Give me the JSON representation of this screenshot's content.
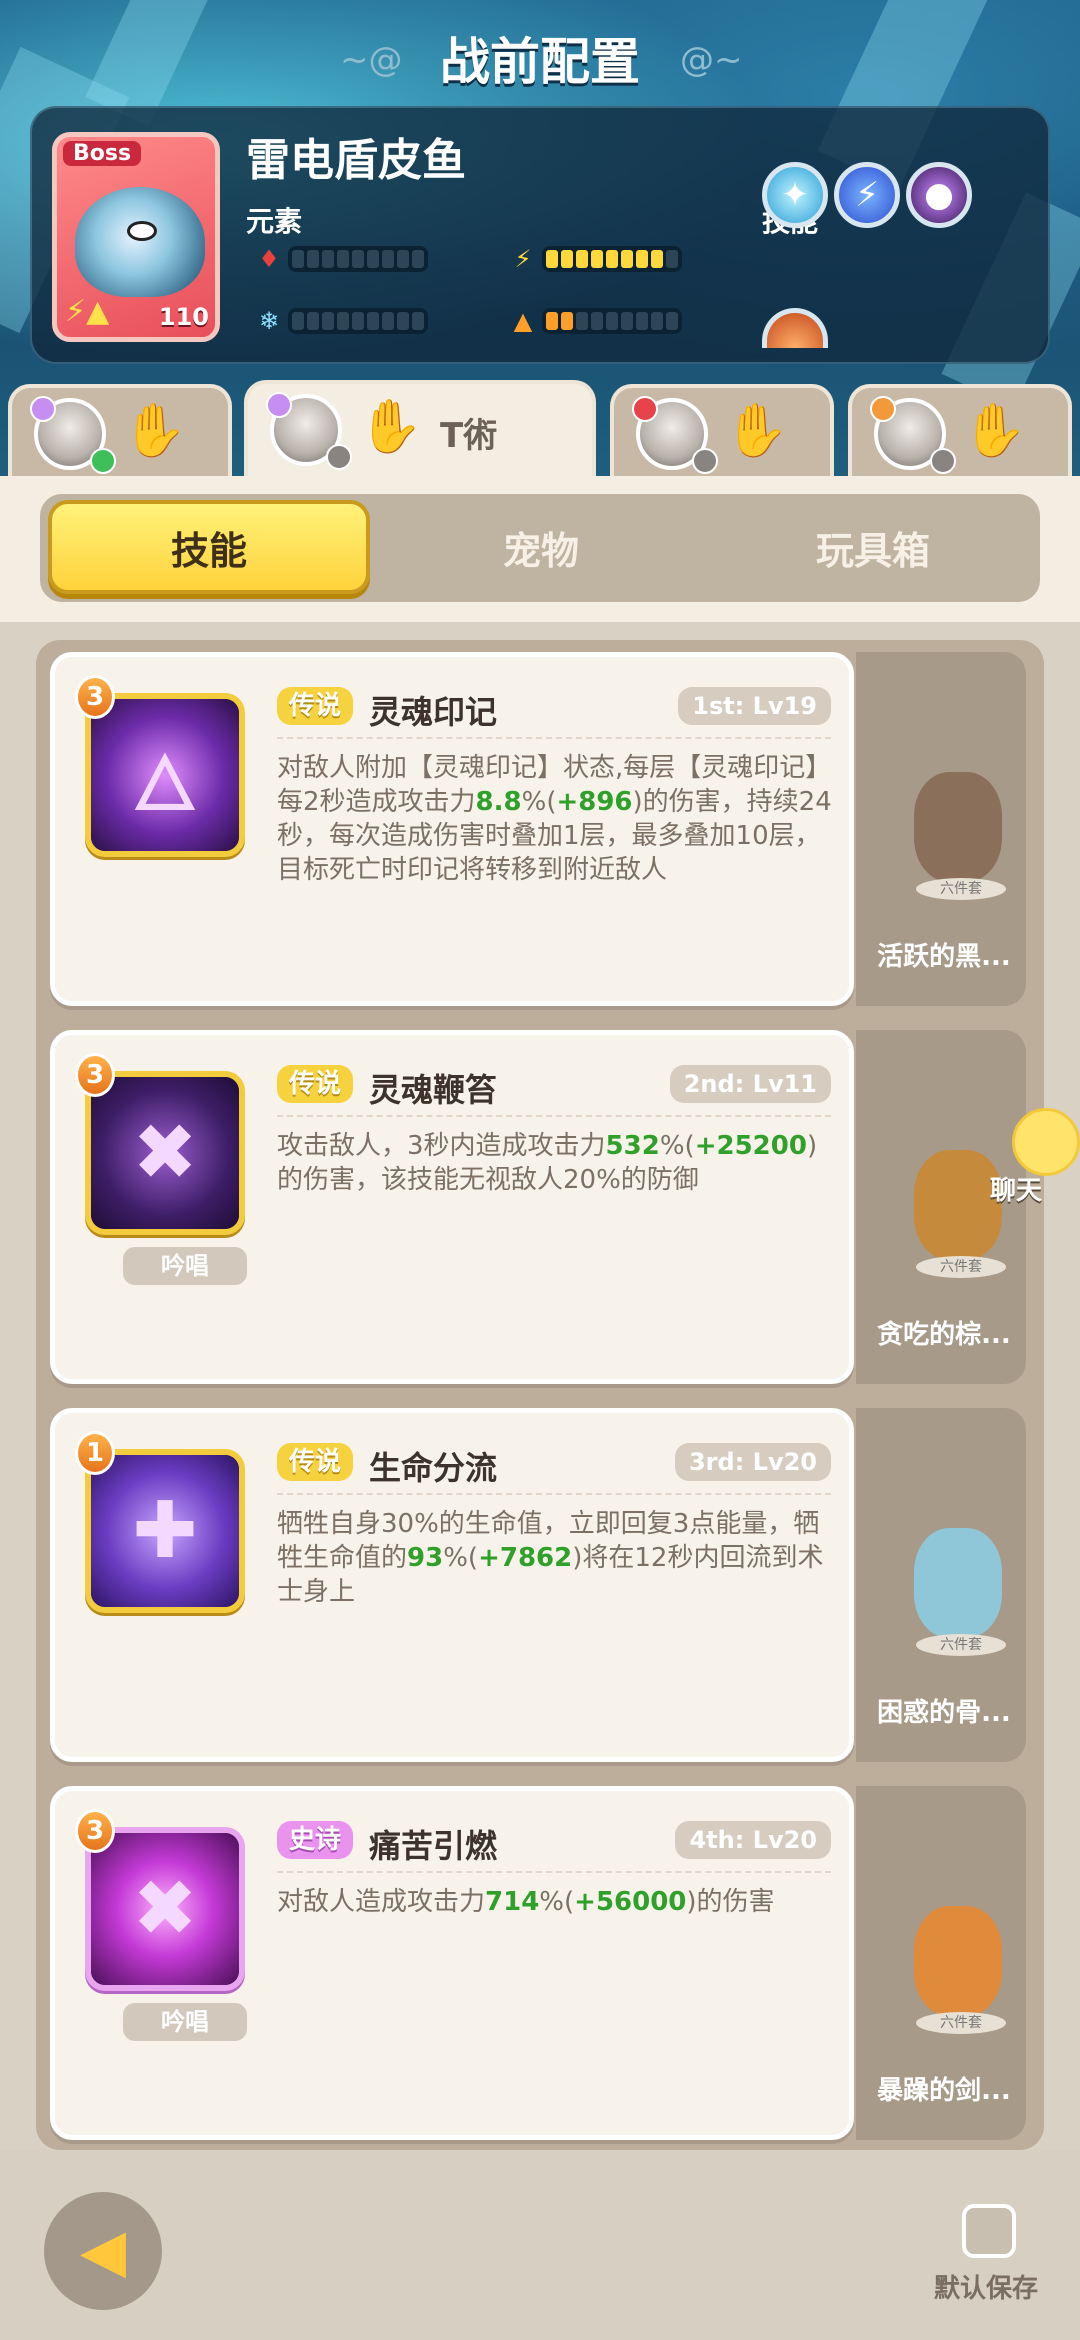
{
  "header": {
    "title": "战前配置",
    "boss": {
      "tag": "Boss",
      "name": "雷电盾皮鱼",
      "level": "110",
      "elements_label": "元素",
      "skills_label": "技能",
      "element_bars": [
        {
          "icon": "fire-icon",
          "filled": 0,
          "total": 9
        },
        {
          "icon": "lightning-icon",
          "filled": 8,
          "total": 9
        },
        {
          "icon": "ice-icon",
          "filled": 0,
          "total": 9
        },
        {
          "icon": "earth-icon",
          "filled": 2,
          "total": 9
        }
      ],
      "skill_orbs": [
        "ice-shard-icon",
        "lightning-icon",
        "dark-orb-icon",
        "flame-orb-icon"
      ]
    }
  },
  "hero_tabs": [
    {
      "label": "",
      "active": false
    },
    {
      "label": "T術",
      "active": true
    },
    {
      "label": "",
      "active": false
    },
    {
      "label": "",
      "active": false
    }
  ],
  "segment_tabs": {
    "skills": "技能",
    "pets": "宠物",
    "toybox": "玩具箱",
    "active": "skills"
  },
  "skills": [
    {
      "rank": "3",
      "rarity": "传说",
      "name": "灵魂印记",
      "level": "1st: Lv19",
      "chant": "",
      "desc_parts": [
        {
          "t": "对敌人附加【灵魂印记】状态,每层【灵魂印记】每2秒造成攻击力"
        },
        {
          "t": "8.8",
          "hl": true
        },
        {
          "t": "%("
        },
        {
          "t": "+896",
          "hl": true
        },
        {
          "t": ")的伤害，持续24秒，每次造成伤害时叠加1层，最多叠加10层，目标死亡时印记将转移到附近敌人"
        }
      ],
      "pet_name": "活跃的黑..."
    },
    {
      "rank": "3",
      "rarity": "传说",
      "name": "灵魂鞭笞",
      "level": "2nd: Lv11",
      "chant": "吟唱",
      "desc_parts": [
        {
          "t": "攻击敌人，3秒内造成攻击力"
        },
        {
          "t": "532",
          "hl": true
        },
        {
          "t": "%("
        },
        {
          "t": "+25200",
          "hl": true
        },
        {
          "t": ")的伤害，该技能无视敌人20%的防御"
        }
      ],
      "pet_name": "贪吃的棕..."
    },
    {
      "rank": "1",
      "rarity": "传说",
      "name": "生命分流",
      "level": "3rd: Lv20",
      "chant": "",
      "desc_parts": [
        {
          "t": "牺牲自身30%的生命值，立即回复3点能量，牺牲生命值的"
        },
        {
          "t": "93",
          "hl": true
        },
        {
          "t": "%("
        },
        {
          "t": "+7862",
          "hl": true
        },
        {
          "t": ")将在12秒内回流到术士身上"
        }
      ],
      "pet_name": "困惑的骨..."
    },
    {
      "rank": "3",
      "rarity": "史诗",
      "name": "痛苦引燃",
      "level": "4th: Lv20",
      "chant": "吟唱",
      "desc_parts": [
        {
          "t": "对敌人造成攻击力"
        },
        {
          "t": "714",
          "hl": true
        },
        {
          "t": "%("
        },
        {
          "t": "+56000",
          "hl": true
        },
        {
          "t": ")的伤害"
        }
      ],
      "pet_name": "暴躁的剑..."
    }
  ],
  "pet_set_label": "六件套",
  "chat": {
    "label": "聊天"
  },
  "footer": {
    "save_label": "默认保存"
  }
}
